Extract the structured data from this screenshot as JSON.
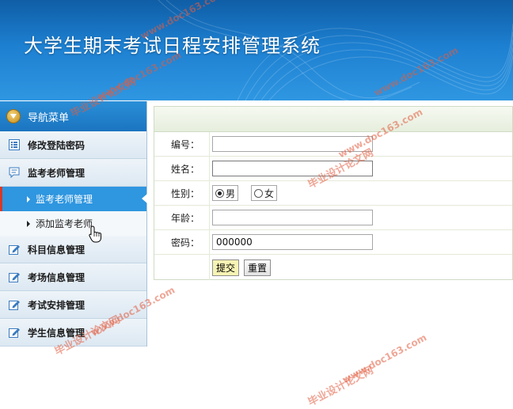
{
  "app": {
    "title": "大学生期末考试日程安排管理系统"
  },
  "sidebar": {
    "header": "导航菜单",
    "items": [
      {
        "label": "修改登陆密码",
        "icon": "list-icon"
      },
      {
        "label": "监考老师管理",
        "icon": "chat-icon",
        "sub": [
          {
            "label": "监考老师管理",
            "active": true
          },
          {
            "label": "添加监考老师",
            "active": false
          }
        ]
      },
      {
        "label": "科目信息管理",
        "icon": "edit-icon"
      },
      {
        "label": "考场信息管理",
        "icon": "edit-icon"
      },
      {
        "label": "考试安排管理",
        "icon": "edit-icon"
      },
      {
        "label": "学生信息管理",
        "icon": "edit-icon"
      }
    ]
  },
  "form": {
    "fields": {
      "id": {
        "label": "编号：",
        "value": ""
      },
      "name": {
        "label": "姓名：",
        "value": ""
      },
      "gender": {
        "label": "性别：",
        "options": [
          "男",
          "女"
        ],
        "selected": "男"
      },
      "age": {
        "label": "年龄：",
        "value": ""
      },
      "password": {
        "label": "密码：",
        "value": "000000"
      }
    },
    "submit_label": "提交",
    "reset_label": "重置"
  },
  "watermarks": [
    "毕业设计论文网",
    "www.doc163.com"
  ],
  "colors": {
    "accent": "#2f96e0",
    "header": "#1d7fd0",
    "watermark": "#e25c40"
  }
}
